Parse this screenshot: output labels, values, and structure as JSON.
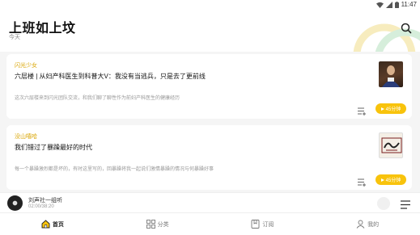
{
  "status_bar": {
    "time": "11:47"
  },
  "header": {
    "title": "上班如上坟",
    "subtitle": "今天"
  },
  "cards": [
    {
      "source": "闪光少女",
      "title": "六层楼 | 从妇产科医生到科普大V：我没有当逃兵，只是去了更前线",
      "desc": "这次六层楼来到闪光团队交流，和我们聊了聊性作为前妇产科医生的健康经历",
      "play_label": "45分钟"
    },
    {
      "source": "没山嘻哈",
      "title": "我们错过了暴躁最好的时代",
      "desc": "每一个暴躁激烈都是坏的，有时这里写的，回暴躁将我一起说们激情暴躁的情况与何暴躁好事",
      "play_label": "45分钟"
    }
  ],
  "mini_player": {
    "title": "刘声社一组听",
    "time": "02:00/38:20"
  },
  "nav": [
    {
      "label": "首页",
      "icon": "home-icon",
      "active": true
    },
    {
      "label": "分类",
      "icon": "grid-icon",
      "active": false
    },
    {
      "label": "订阅",
      "icon": "bookmark-icon",
      "active": false
    },
    {
      "label": "我的",
      "icon": "person-icon",
      "active": false
    }
  ],
  "colors": {
    "accent": "#f8c30c",
    "source_text": "#d9a400"
  }
}
